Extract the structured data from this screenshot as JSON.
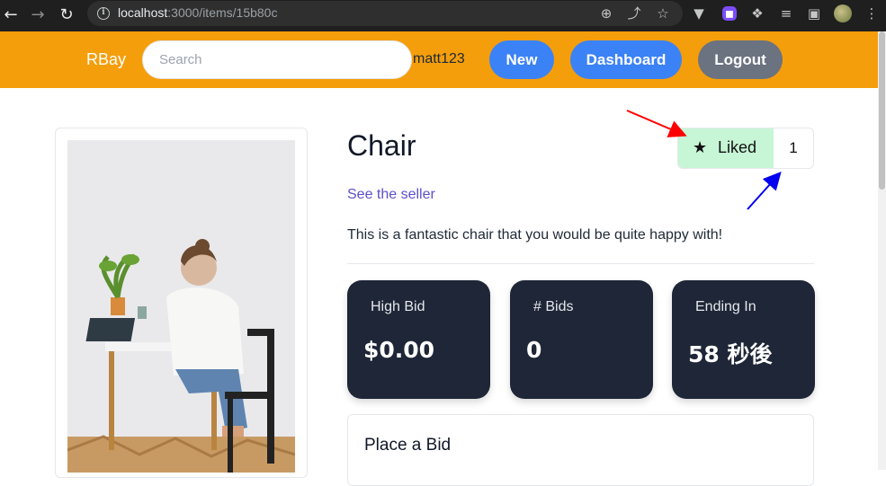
{
  "browser": {
    "url_host": "localhost",
    "url_rest": ":3000/items/15b80c",
    "back_icon": "arrow-left-icon",
    "forward_icon": "arrow-right-icon",
    "reload_icon": "reload-icon"
  },
  "header": {
    "brand": "RBay",
    "search_placeholder": "Search",
    "username": "matt123",
    "new_label": "New",
    "dashboard_label": "Dashboard",
    "logout_label": "Logout",
    "colors": {
      "bar": "#f59e0b",
      "blue": "#3b82f6",
      "gray": "#6b7280"
    }
  },
  "item": {
    "title": "Chair",
    "seller_link": "See the seller",
    "description": "This is a fantastic chair that you would be quite happy with!",
    "like_label": "Liked",
    "like_count": "1",
    "like_bg": "#c6f6d5"
  },
  "stats": [
    {
      "label": "High Bid",
      "value": "$0.00"
    },
    {
      "label": "# Bids",
      "value": "0"
    },
    {
      "label": "Ending In",
      "value": "58 秒後"
    }
  ],
  "bid_panel": {
    "title": "Place a Bid"
  },
  "annotations": {
    "red_arrow_color": "#ff0000",
    "blue_arrow_color": "#0000ee"
  }
}
